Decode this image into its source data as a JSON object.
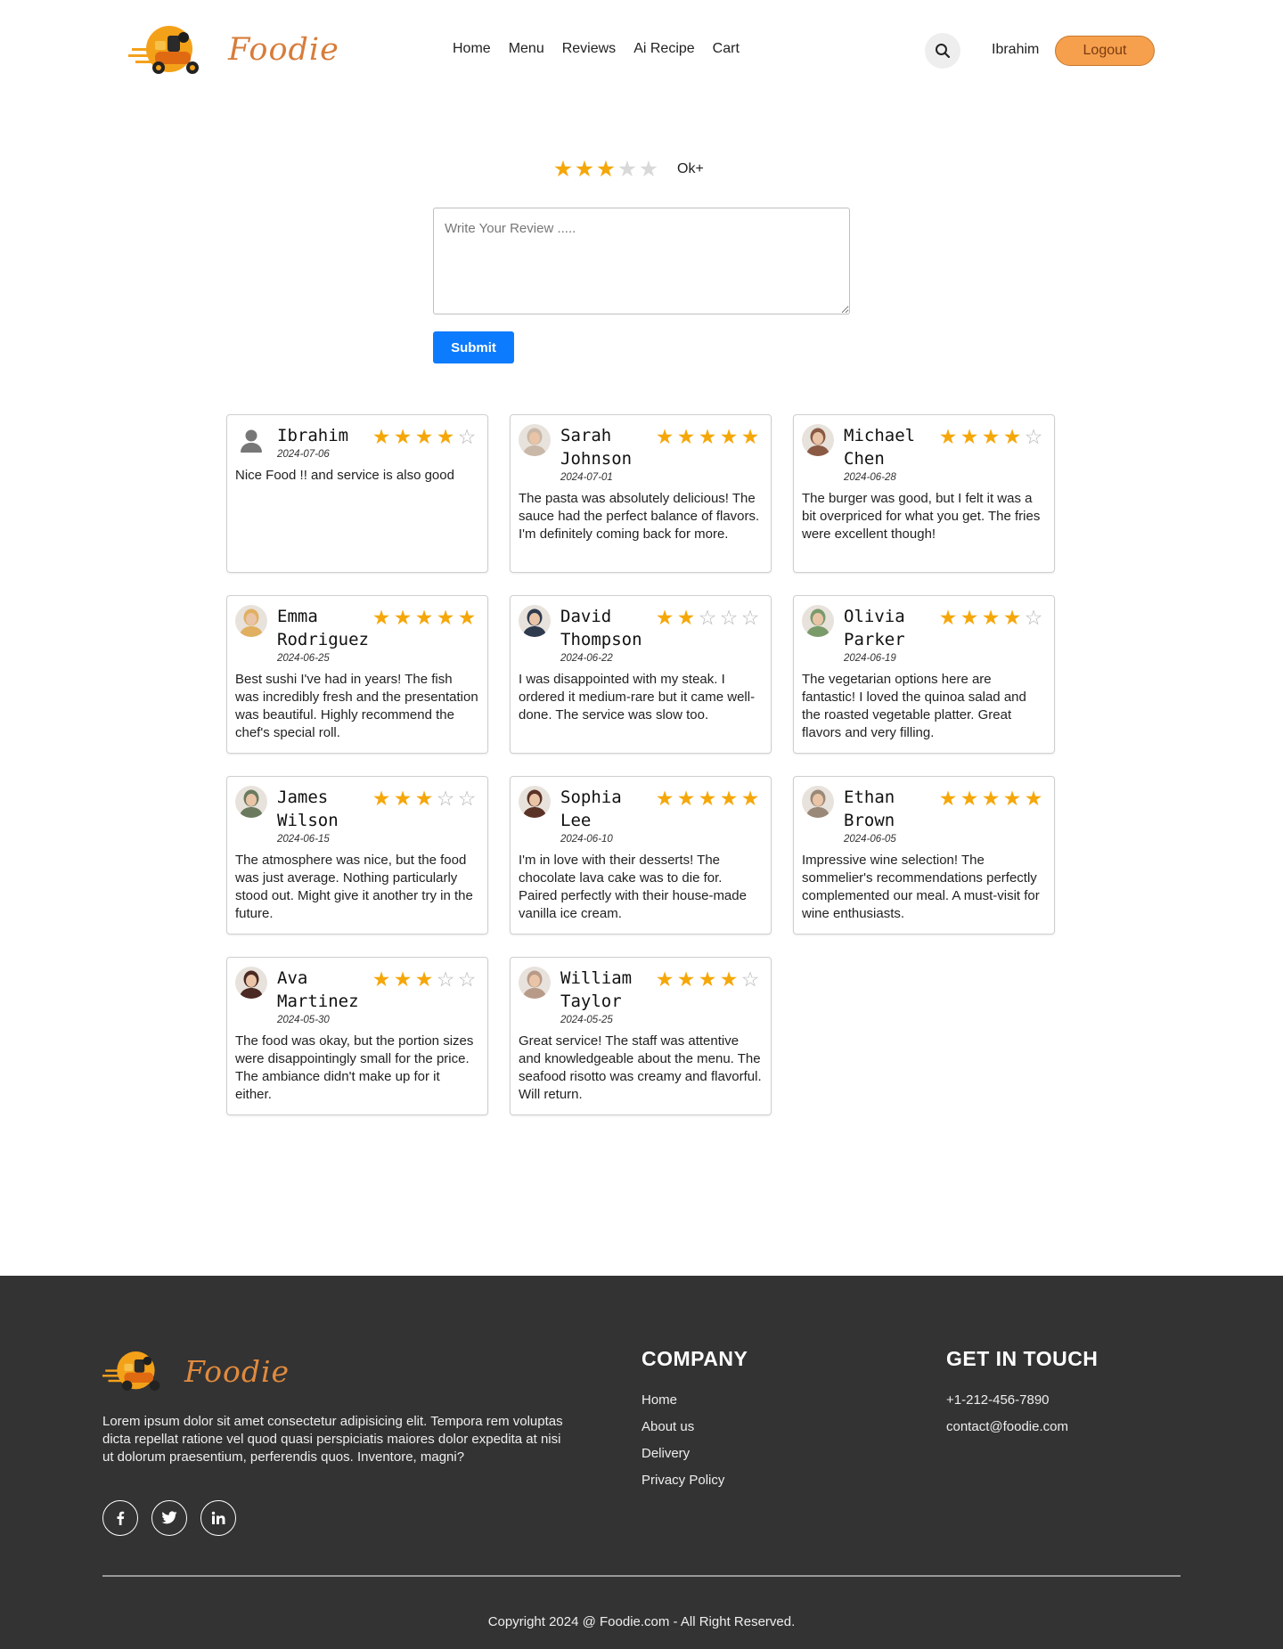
{
  "brand": {
    "name": "Foodie",
    "accent": "#d77c3a"
  },
  "nav": {
    "items": [
      "Home",
      "Menu",
      "Reviews",
      "Ai Recipe",
      "Cart"
    ]
  },
  "header": {
    "search_icon": "search-icon",
    "user_name": "Ibrahim",
    "logout_label": "Logout"
  },
  "rating_input": {
    "value": 3,
    "max": 5,
    "label": "Ok+"
  },
  "review_form": {
    "placeholder": "Write Your Review .....",
    "value": "",
    "submit_label": "Submit"
  },
  "reviews": [
    {
      "name": "Ibrahim",
      "date": "2024-07-06",
      "rating": 4,
      "text": "Nice Food !! and service is also good",
      "avatar": "default"
    },
    {
      "name": "Sarah Johnson",
      "date": "2024-07-01",
      "rating": 5,
      "text": "The pasta was absolutely delicious! The sauce had the perfect balance of flavors. I'm definitely coming back for more.",
      "avatar": "#c9b8a8"
    },
    {
      "name": "Michael Chen",
      "date": "2024-06-28",
      "rating": 4,
      "text": "The burger was good, but I felt it was a bit overpriced for what you get. The fries were excellent though!",
      "avatar": "#8a5a44"
    },
    {
      "name": "Emma Rodriguez",
      "date": "2024-06-25",
      "rating": 5,
      "text": "Best sushi I've had in years! The fish was incredibly fresh and the presentation was beautiful. Highly recommend the chef's special roll.",
      "avatar": "#e0b060"
    },
    {
      "name": "David Thompson",
      "date": "2024-06-22",
      "rating": 2,
      "text": "I was disappointed with my steak. I ordered it medium-rare but it came well-done. The service was slow too.",
      "avatar": "#2e3a4e"
    },
    {
      "name": "Olivia Parker",
      "date": "2024-06-19",
      "rating": 4,
      "text": "The vegetarian options here are fantastic! I loved the quinoa salad and the roasted vegetable platter. Great flavors and very filling.",
      "avatar": "#7a9a6a"
    },
    {
      "name": "James Wilson",
      "date": "2024-06-15",
      "rating": 3,
      "text": "The atmosphere was nice, but the food was just average. Nothing particularly stood out. Might give it another try in the future.",
      "avatar": "#6b7a5e"
    },
    {
      "name": "Sophia Lee",
      "date": "2024-06-10",
      "rating": 5,
      "text": "I'm in love with their desserts! The chocolate lava cake was to die for. Paired perfectly with their house-made vanilla ice cream.",
      "avatar": "#5a3226"
    },
    {
      "name": "Ethan Brown",
      "date": "2024-06-05",
      "rating": 5,
      "text": "Impressive wine selection! The sommelier's recommendations perfectly complemented our meal. A must-visit for wine enthusiasts.",
      "avatar": "#9a8878"
    },
    {
      "name": "Ava Martinez",
      "date": "2024-05-30",
      "rating": 3,
      "text": "The food was okay, but the portion sizes were disappointingly small for the price. The ambiance didn't make up for it either.",
      "avatar": "#4a2a22"
    },
    {
      "name": "William Taylor",
      "date": "2024-05-25",
      "rating": 4,
      "text": "Great service! The staff was attentive and knowledgeable about the menu. The seafood risotto was creamy and flavorful. Will return.",
      "avatar": "#b89a88"
    }
  ],
  "colors": {
    "star_on": "#f5a70a",
    "star_off": "#b5b5b5",
    "submit": "#0d7bfd",
    "logout": "#f6a04d",
    "footer_bg": "#333333"
  },
  "footer": {
    "description": "Lorem ipsum dolor sit amet consectetur adipisicing elit. Tempora rem voluptas dicta repellat ratione vel quod quasi perspiciatis maiores dolor expedita at nisi ut dolorum praesentium, perferendis quos. Inventore, magni?",
    "socials": [
      "facebook-icon",
      "twitter-icon",
      "linkedin-icon"
    ],
    "company": {
      "title": "COMPANY",
      "links": [
        "Home",
        "About us",
        "Delivery",
        "Privacy Policy"
      ]
    },
    "contact": {
      "title": "GET IN TOUCH",
      "phone": "+1-212-456-7890",
      "email": "contact@foodie.com"
    },
    "copyright": "Copyright 2024 @ Foodie.com - All Right Reserved."
  }
}
